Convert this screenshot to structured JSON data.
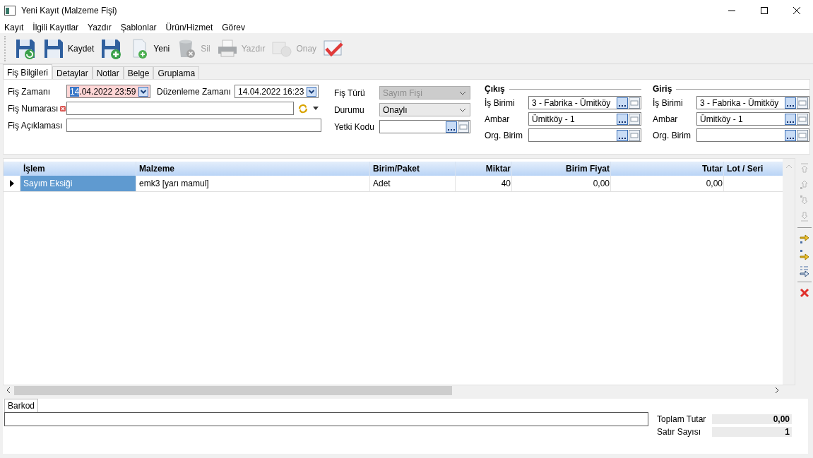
{
  "window": {
    "title": "Yeni Kayıt (Malzeme Fişi)"
  },
  "menu": [
    "Kayıt",
    "İlgili Kayıtlar",
    "Yazdır",
    "Şablonlar",
    "Ürün/Hizmet",
    "Görev"
  ],
  "toolbar": [
    {
      "kind": "save-refresh",
      "disabled": false
    },
    {
      "kind": "save",
      "label": "Kaydet",
      "disabled": false
    },
    {
      "kind": "save-new",
      "disabled": false
    },
    {
      "kind": "new",
      "label": "Yeni",
      "disabled": false
    },
    {
      "kind": "delete",
      "label": "Sil",
      "disabled": true
    },
    {
      "kind": "print",
      "label": "Yazdır",
      "disabled": true
    },
    {
      "kind": "approve",
      "label": "Onay",
      "disabled": true
    },
    {
      "kind": "check",
      "disabled": false
    }
  ],
  "tabs": [
    {
      "label": "Fiş Bilgileri",
      "selected": true
    },
    {
      "label": "Detaylar",
      "selected": false
    },
    {
      "label": "Notlar",
      "selected": false
    },
    {
      "label": "Belge",
      "selected": false
    },
    {
      "label": "Gruplama",
      "selected": false
    }
  ],
  "form": {
    "fis_zamani": {
      "label": "Fiş Zamanı",
      "value_selected": "14",
      "value_rest": ".04.2022 23:59",
      "invalid": true
    },
    "duzenleme_zamani": {
      "label": "Düzenleme Zamanı",
      "value": "14.04.2022 16:23"
    },
    "fis_numarasi": {
      "label": "Fiş Numarası",
      "required": true
    },
    "fis_aciklamasi": {
      "label": "Fiş Açıklaması"
    },
    "fis_turu": {
      "label": "Fiş Türü",
      "value": "Sayım Fişi",
      "disabled": true
    },
    "durumu": {
      "label": "Durumu",
      "value": "Onaylı",
      "disabled": false
    },
    "yetki_kodu": {
      "label": "Yetki Kodu"
    }
  },
  "groups": [
    {
      "title": "Çıkış",
      "fields": [
        {
          "label": "İş Birimi",
          "value": "3 - Fabrika - Ümitköy"
        },
        {
          "label": "Ambar",
          "value": "Ümitköy - 1"
        },
        {
          "label": "Org. Birim"
        }
      ]
    },
    {
      "title": "Giriş",
      "fields": [
        {
          "label": "İş Birimi",
          "value": "3 - Fabrika - Ümitköy"
        },
        {
          "label": "Ambar",
          "value": "Ümitköy - 1"
        },
        {
          "label": "Org. Birim"
        }
      ]
    }
  ],
  "grid": {
    "columns": [
      {
        "label": "İşlem",
        "numeric": false
      },
      {
        "label": "Malzeme",
        "numeric": false
      },
      {
        "label": "Birim/Paket",
        "numeric": false
      },
      {
        "label": "Miktar",
        "numeric": true
      },
      {
        "label": "Birim Fiyat",
        "numeric": true
      },
      {
        "label": "Tutar",
        "numeric": true
      },
      {
        "label": "Lot / Seri",
        "numeric": false
      }
    ],
    "rows": [
      {
        "selected": true,
        "cells": [
          "Sayım Eksiği",
          "emk3 [yarı mamul]",
          "Adet",
          "40",
          "0,00",
          "0,00",
          ""
        ]
      }
    ]
  },
  "side_tools": [
    {
      "kind": "move-top",
      "disabled": true
    },
    {
      "kind": "move-up",
      "disabled": true
    },
    {
      "kind": "move-down",
      "disabled": true
    },
    {
      "kind": "move-bottom",
      "disabled": true
    },
    {
      "kind": "insert-after",
      "disabled": false
    },
    {
      "kind": "insert-before",
      "disabled": false
    },
    {
      "kind": "insert-child",
      "disabled": false
    },
    {
      "kind": "delete",
      "disabled": false
    }
  ],
  "barcode": {
    "tab": "Barkod"
  },
  "totals": [
    {
      "label": "Toplam Tutar",
      "value": "0,00"
    },
    {
      "label": "Satır Sayısı",
      "value": "1"
    }
  ]
}
